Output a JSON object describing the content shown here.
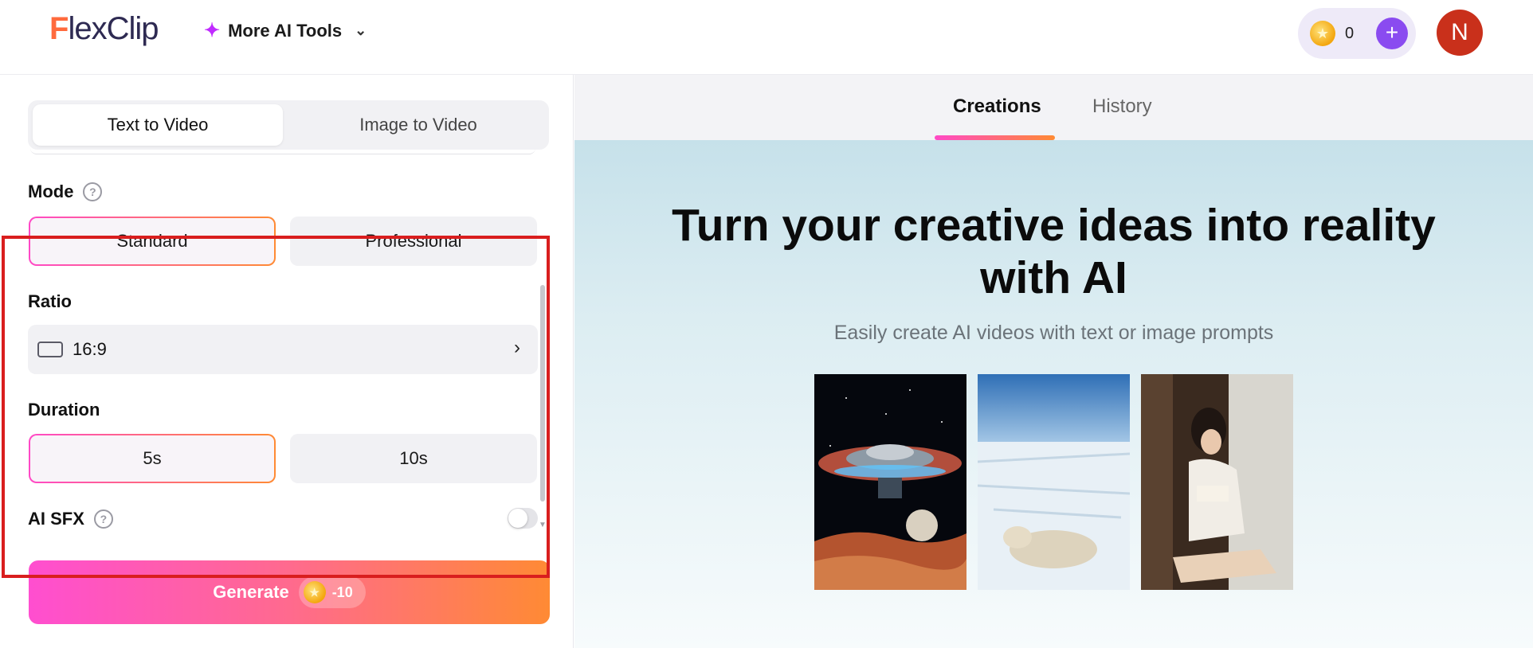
{
  "header": {
    "logo": "FlexClip",
    "logo_initial": "F",
    "logo_rest": "lexClip",
    "ai_tools_label": "More AI Tools",
    "credits": "0",
    "avatar_initial": "N"
  },
  "left_panel": {
    "tabs": [
      {
        "label": "Text to Video",
        "active": true
      },
      {
        "label": "Image to Video",
        "active": false
      }
    ],
    "mode": {
      "label": "Mode",
      "options": [
        {
          "label": "Standard",
          "selected": true
        },
        {
          "label": "Professional",
          "selected": false
        }
      ]
    },
    "ratio": {
      "label": "Ratio",
      "value": "16:9"
    },
    "duration": {
      "label": "Duration",
      "options": [
        {
          "label": "5s",
          "selected": true
        },
        {
          "label": "10s",
          "selected": false
        }
      ]
    },
    "ai_sfx": {
      "label": "AI SFX",
      "enabled": false
    },
    "generate": {
      "label": "Generate",
      "cost": "-10"
    }
  },
  "right_panel": {
    "tabs": [
      {
        "label": "Creations",
        "active": true
      },
      {
        "label": "History",
        "active": false
      }
    ],
    "hero_title": "Turn your creative ideas into reality with AI",
    "hero_subtitle": "Easily create AI videos with text or image prompts",
    "thumbnails": [
      {
        "subject": "ufo-over-desert-planet"
      },
      {
        "subject": "polar-bear-on-ice"
      },
      {
        "subject": "girl-reading-by-window"
      }
    ]
  },
  "colors": {
    "accent_gradient_start": "#ff49c6",
    "accent_gradient_end": "#ff8a34",
    "highlight_border": "#d91e1e",
    "plus_button": "#8a4bf0",
    "avatar": "#c9301b"
  }
}
